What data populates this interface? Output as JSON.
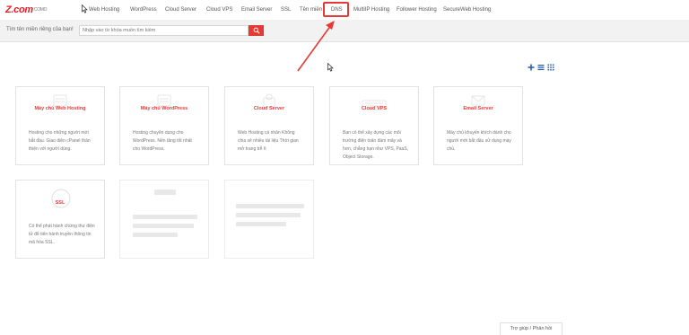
{
  "brand": {
    "logo_text": "Z.com",
    "logo_sub": "COMO"
  },
  "nav": {
    "items": [
      {
        "label": "Web Hosting"
      },
      {
        "label": "WordPress"
      },
      {
        "label": "Cloud Server"
      },
      {
        "label": "Cloud VPS"
      },
      {
        "label": "Email Server"
      },
      {
        "label": "SSL"
      },
      {
        "label": "Tên miền"
      },
      {
        "label": "DNS"
      },
      {
        "label": "MultiIP Hosting"
      },
      {
        "label": "Follower Hosting"
      },
      {
        "label": "SecureWeb Hosting"
      }
    ],
    "highlighted": "DNS",
    "highlight_color": "#e53935"
  },
  "search": {
    "label": "Tìm tên miền riêng của bạn!",
    "placeholder": "Nhập vào từ khóa muốn tìm kiếm",
    "button_icon": "search-icon"
  },
  "view_icons": [
    "add-icon",
    "list-view-icon",
    "grid-view-icon"
  ],
  "cards": [
    {
      "title": "Máy chủ Web Hosting",
      "desc": "Hosting cho những người mới bắt đầu. Giao diện cPanel thân thiện với người dùng.",
      "icon": "server-icon"
    },
    {
      "title": "Máy chủ WordPress",
      "desc": "Hosting chuyên dụng cho WordPress. Nền tảng tốt nhất cho WordPress.",
      "icon": "server-icon"
    },
    {
      "title": "Cloud Server",
      "desc": "Web Hosting cá nhân Không chia sẻ nhiều tài liệu Thời gian mở trang trễ ít",
      "icon": "cloud-server-icon"
    },
    {
      "title": "Cloud VPS",
      "desc": "Bạn có thể xây dựng các môi trường điện toán đám mây và hơn, chẳng hạn như VPS, PaaS, Object Storage.",
      "icon": "vps-icon"
    },
    {
      "title": "Email Server",
      "desc": "Máy chủ khuyến khích dành cho người mới bắt đầu sử dụng máy chủ.",
      "icon": "email-icon"
    },
    {
      "title": "SSL",
      "desc": "Có thể phát hành chứng thư điện tử để tiến hành truyền thông tin mã hóa SSL.",
      "icon": "ssl-badge-icon"
    }
  ],
  "footer": {
    "help_label": "Trợ giúp / Phản hồi"
  }
}
